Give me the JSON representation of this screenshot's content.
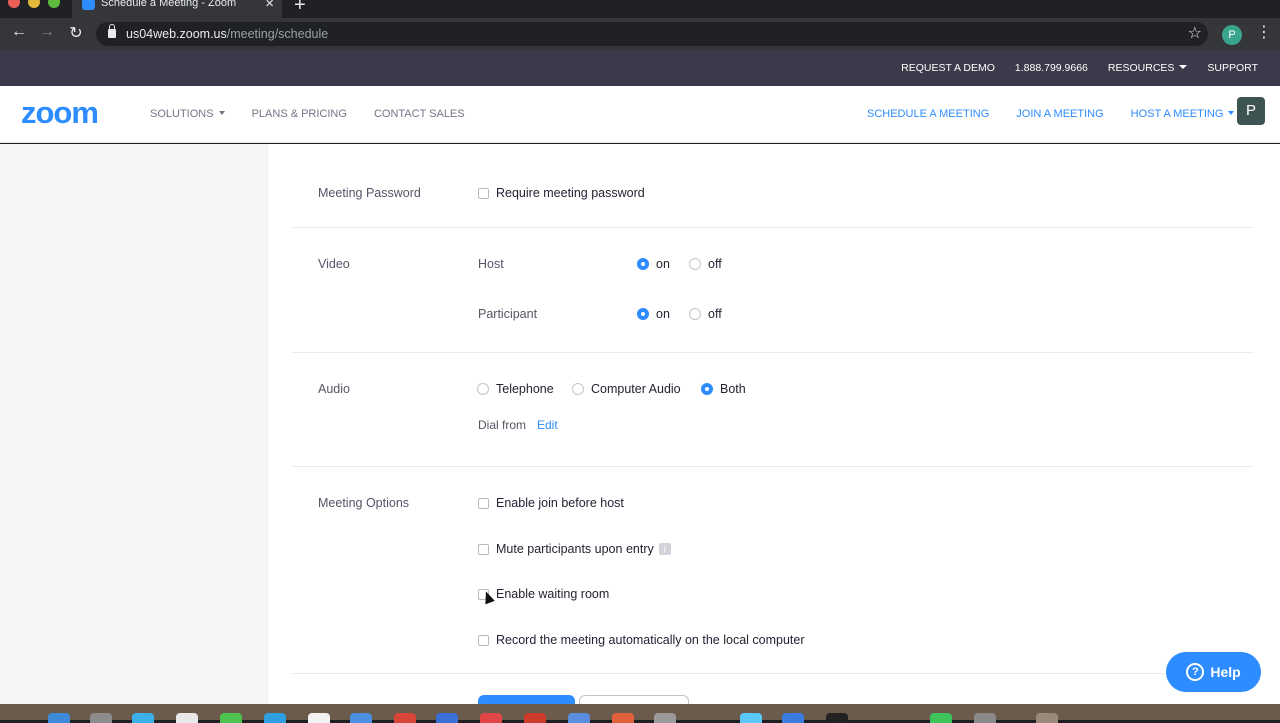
{
  "browser": {
    "tab_title": "Schedule a Meeting - Zoom",
    "new_tab": "+",
    "url_host": "us04web.zoom.us",
    "url_path": "/meeting/schedule",
    "profile_initial": "P"
  },
  "topbar": {
    "request_demo": "REQUEST A DEMO",
    "phone": "1.888.799.9666",
    "resources": "RESOURCES",
    "support": "SUPPORT"
  },
  "nav": {
    "logo": "zoom",
    "solutions": "SOLUTIONS",
    "plans": "PLANS & PRICING",
    "contact": "CONTACT SALES",
    "schedule": "SCHEDULE A MEETING",
    "join": "JOIN A MEETING",
    "host": "HOST A MEETING",
    "avatar": "P"
  },
  "form": {
    "password": {
      "label": "Meeting Password",
      "option": "Require meeting password",
      "checked": false
    },
    "video": {
      "label": "Video",
      "host_label": "Host",
      "participant_label": "Participant",
      "on": "on",
      "off": "off",
      "host_value": "on",
      "participant_value": "on"
    },
    "audio": {
      "label": "Audio",
      "telephone": "Telephone",
      "computer": "Computer Audio",
      "both": "Both",
      "selected": "Both",
      "dial_from": "Dial from",
      "edit": "Edit"
    },
    "options": {
      "label": "Meeting Options",
      "join_before_host": "Enable join before host",
      "mute_on_entry": "Mute participants upon entry",
      "waiting_room": "Enable waiting room",
      "record_local": "Record the meeting automatically on the local computer"
    }
  },
  "help": {
    "label": "Help",
    "icon": "?"
  },
  "colors": {
    "accent": "#2d8cff",
    "topbar": "#3b3a4a"
  }
}
